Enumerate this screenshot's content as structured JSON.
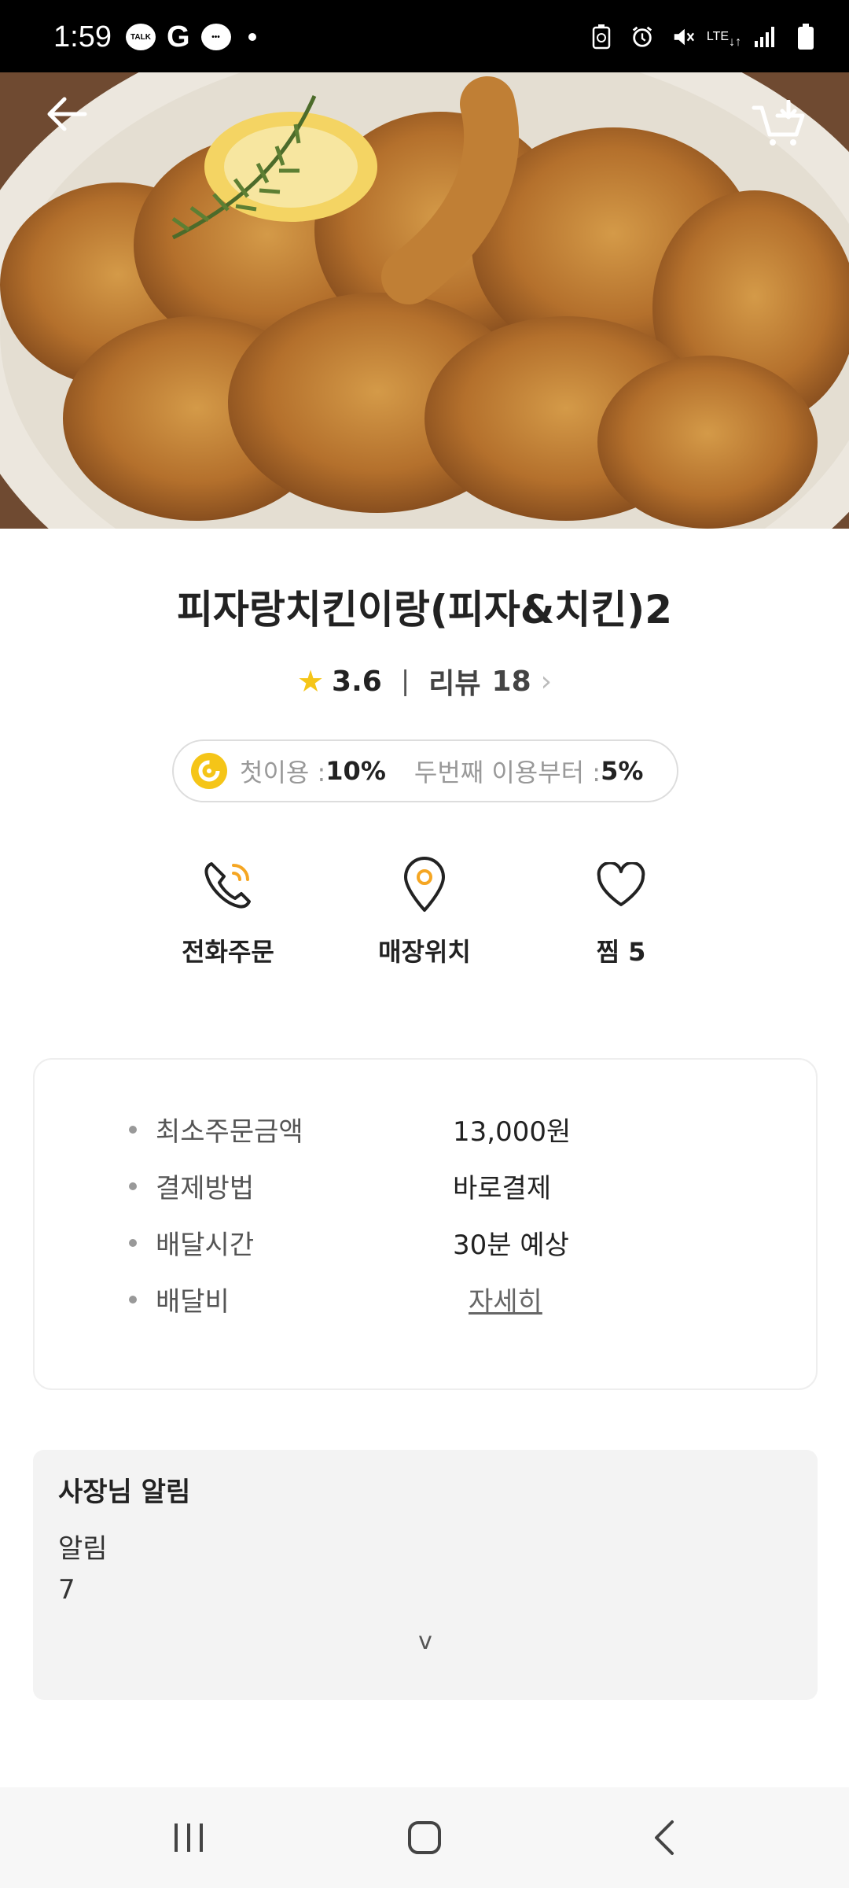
{
  "status_bar": {
    "time": "1:59",
    "talk_badge": "TALK",
    "g_glyph": "G",
    "network": "LTE"
  },
  "header": {
    "back_icon": "back-arrow-icon",
    "cart_icon": "cart-icon"
  },
  "store": {
    "name": "피자랑치킨이랑(피자&치킨)2",
    "rating": "3.6",
    "separator": "|",
    "review_label": "리뷰",
    "review_count": "18"
  },
  "coupon": {
    "first_label": "첫이용 : ",
    "first_value": "10%",
    "second_label": "두번째 이용부터 : ",
    "second_value": "5%"
  },
  "actions": [
    {
      "label": "전화주문",
      "icon": "phone-icon"
    },
    {
      "label": "매장위치",
      "icon": "location-pin-icon"
    },
    {
      "label": "찜 5",
      "icon": "heart-icon"
    }
  ],
  "info": {
    "min_order_label": "최소주문금액",
    "min_order_value": "13,000원",
    "payment_label": "결제방법",
    "payment_value": "바로결제",
    "delivery_time_label": "배달시간",
    "delivery_time_value": "30분 예상",
    "delivery_fee_label": "배달비",
    "delivery_fee_link": "자세히"
  },
  "notice": {
    "title": "사장님 알림",
    "line1": "알림",
    "line2": "7",
    "expand": "v"
  },
  "colors": {
    "accent": "#f5c518",
    "pin": "#f5a623"
  }
}
